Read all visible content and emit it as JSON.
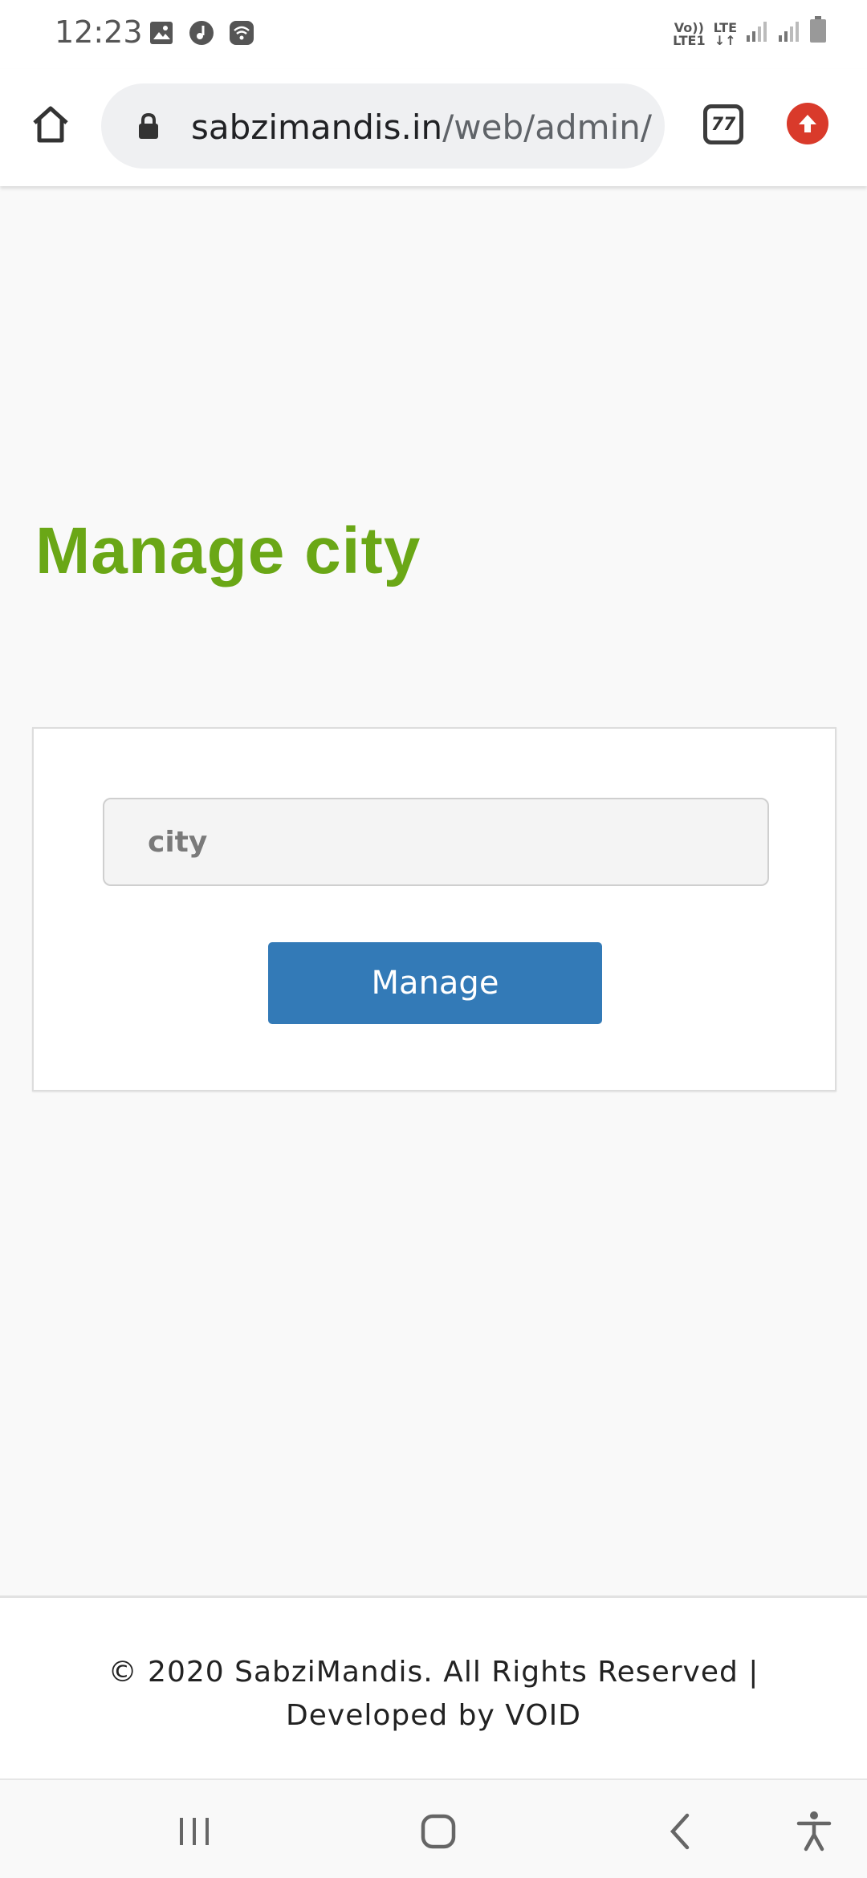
{
  "status_bar": {
    "time": "12:23",
    "icons_left": [
      "gallery-icon",
      "music-icon",
      "wifi-icon"
    ],
    "network_label_1": "Vo))",
    "network_label_2": "LTE1",
    "network_label_3": "LTE"
  },
  "browser": {
    "url_host": "sabzimandis.in",
    "url_path": "/web/admin/",
    "tab_count": "77"
  },
  "page": {
    "title": "Manage city",
    "city_placeholder": "city",
    "manage_label": "Manage"
  },
  "footer": {
    "text": "© 2020 SabziMandis. All Rights Reserved | Developed by VOID"
  },
  "colors": {
    "title_green": "#6aa716",
    "button_blue": "#337ab7",
    "update_red": "#d93a2b"
  }
}
